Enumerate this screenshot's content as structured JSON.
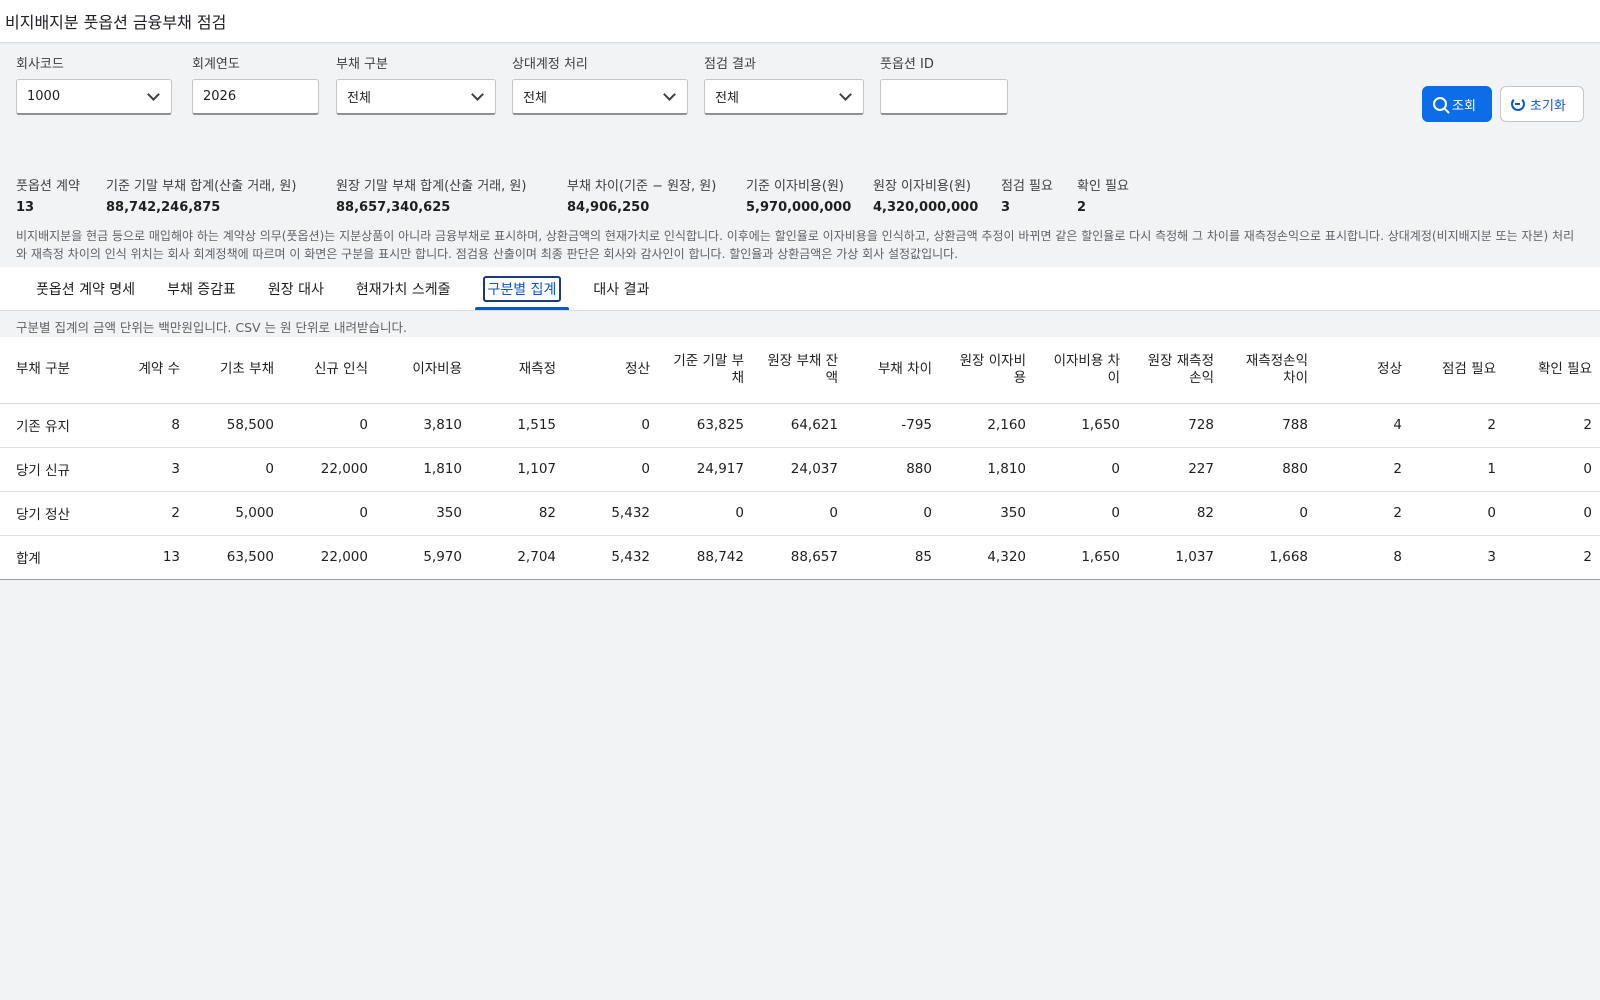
{
  "title": "비지배지분 풋옵션 금융부채 점검",
  "filters": {
    "company_code": {
      "label": "회사코드",
      "value": "1000"
    },
    "fiscal_year": {
      "label": "회계연도",
      "value": "2026"
    },
    "liability_type": {
      "label": "부채 구분",
      "value": "전체"
    },
    "counter_account": {
      "label": "상대계정 처리",
      "value": "전체"
    },
    "check_result": {
      "label": "점검 결과",
      "value": "전체"
    },
    "put_option_id": {
      "label": "풋옵션 ID",
      "value": ""
    }
  },
  "buttons": {
    "search": "조회",
    "reset": "초기화"
  },
  "summary": [
    {
      "label": "풋옵션 계약",
      "value": "13"
    },
    {
      "label": "기준 기말 부채 합계(산출 거래, 원)",
      "value": "88,742,246,875"
    },
    {
      "label": "원장 기말 부채 합계(산출 거래, 원)",
      "value": "88,657,340,625"
    },
    {
      "label": "부채 차이(기준 − 원장, 원)",
      "value": "84,906,250"
    },
    {
      "label": "기준 이자비용(원)",
      "value": "5,970,000,000"
    },
    {
      "label": "원장 이자비용(원)",
      "value": "4,320,000,000"
    },
    {
      "label": "점검 필요",
      "value": "3"
    },
    {
      "label": "확인 필요",
      "value": "2"
    }
  ],
  "note": "비지배지분을 현금 등으로 매입해야 하는 계약상 의무(풋옵션)는 지분상품이 아니라 금융부채로 표시하며, 상환금액의 현재가치로 인식합니다. 이후에는 할인율로 이자비용을 인식하고, 상환금액 추정이 바뀌면 같은 할인율로 다시 측정해 그 차이를 재측정손익으로 표시합니다. 상대계정(비지배지분 또는 자본) 처리와 재측정 차이의 인식 위치는 회사 회계정책에 따르며 이 화면은 구분을 표시만 합니다. 점검용 산출이며 최종 판단은 회사와 감사인이 합니다. 할인율과 상환금액은 가상 회사 설정값입니다.",
  "tabs": [
    "풋옵션 계약 명세",
    "부채 증감표",
    "원장 대사",
    "현재가치 스케줄",
    "구분별 집계",
    "대사 결과"
  ],
  "active_tab": 4,
  "unit_note": "구분별 집계의 금액 단위는 백만원입니다. CSV 는 원 단위로 내려받습니다.",
  "table": {
    "headers": [
      "부채 구분",
      "계약 수",
      "기초 부채",
      "신규 인식",
      "이자비용",
      "재측정",
      "정산",
      "기준 기말 부\n채",
      "원장 부채 잔\n액",
      "부채 차이",
      "원장 이자비\n용",
      "이자비용 차\n이",
      "원장 재측정\n손익",
      "재측정손익\n차이",
      "정상",
      "점검 필요",
      "확인 필요"
    ],
    "rows": [
      [
        "기존 유지",
        "8",
        "58,500",
        "0",
        "3,810",
        "1,515",
        "0",
        "63,825",
        "64,621",
        "-795",
        "2,160",
        "1,650",
        "728",
        "788",
        "4",
        "2",
        "2"
      ],
      [
        "당기 신규",
        "3",
        "0",
        "22,000",
        "1,810",
        "1,107",
        "0",
        "24,917",
        "24,037",
        "880",
        "1,810",
        "0",
        "227",
        "880",
        "2",
        "1",
        "0"
      ],
      [
        "당기 정산",
        "2",
        "5,000",
        "0",
        "350",
        "82",
        "5,432",
        "0",
        "0",
        "0",
        "350",
        "0",
        "82",
        "0",
        "2",
        "0",
        "0"
      ],
      [
        "합계",
        "13",
        "63,500",
        "22,000",
        "5,970",
        "2,704",
        "5,432",
        "88,742",
        "88,657",
        "85",
        "4,320",
        "1,650",
        "1,037",
        "1,668",
        "8",
        "3",
        "2"
      ]
    ]
  }
}
